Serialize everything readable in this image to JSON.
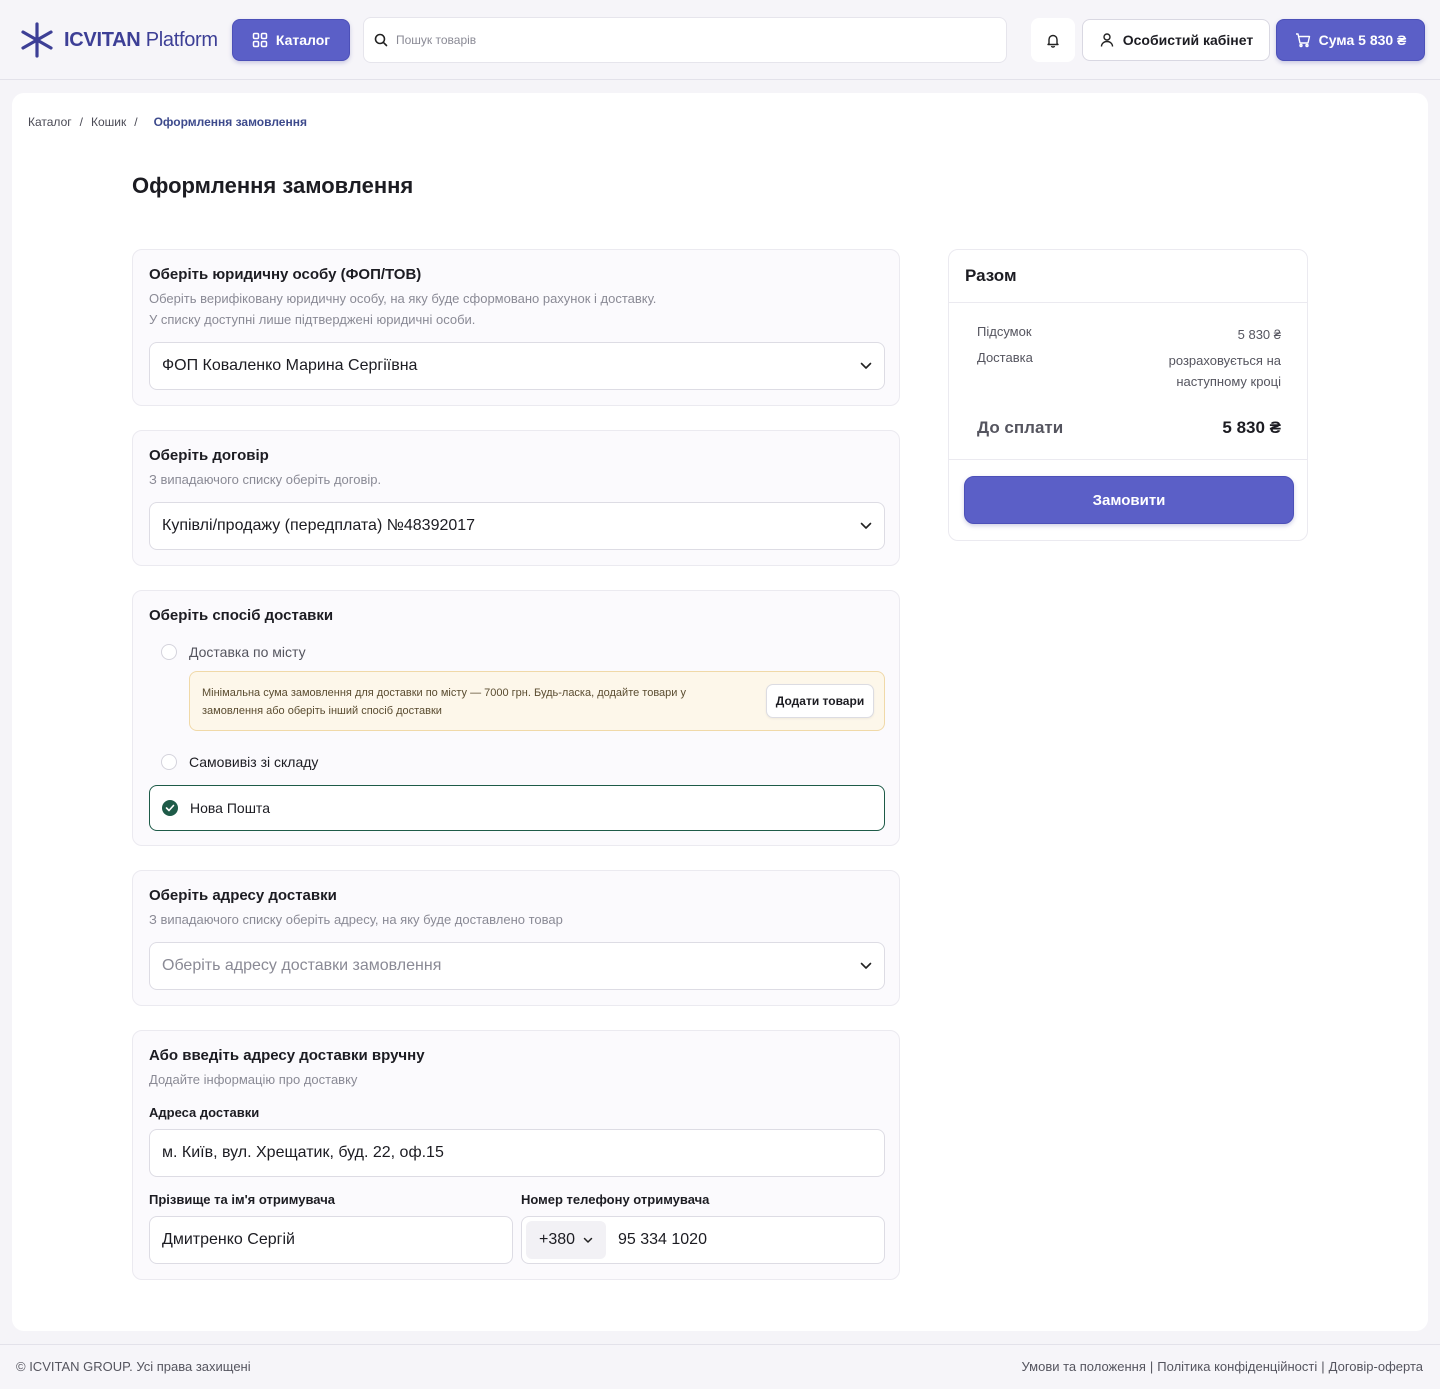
{
  "header": {
    "brand": "ICVITAN",
    "brand_suffix": "Platform",
    "catalog_label": "Каталог",
    "search_placeholder": "Пошук товарів",
    "account_label": "Особистий кабінет",
    "cart_label": "Сума 5 830 ₴"
  },
  "breadcrumb": {
    "items": [
      "Каталог",
      "Кошик"
    ],
    "current": "Оформлення замовлення"
  },
  "page_title": "Оформлення замовлення",
  "legal_entity": {
    "title": "Оберіть юридичну особу (ФОП/ТОВ)",
    "desc_1": "Оберіть верифіковану юридичну особу, на яку буде сформовано рахунок і доставку.",
    "desc_2": "У списку доступні лише підтверджені юридичні особи.",
    "selected": "ФОП Коваленко Марина Сергіївна"
  },
  "contract": {
    "title": "Оберіть договір",
    "desc": "З випадаючого списку оберіть договір.",
    "selected": "Купівлі/продажу (передплата) №48392017"
  },
  "delivery": {
    "title": "Оберіть спосіб доставки",
    "option_city": "Доставка по місту",
    "notice": "Мінімальна сума замовлення для доставки по місту — 7000 грн. Будь-ласка, додайте товари у замовлення або оберіть інший спосіб доставки",
    "add_items_label": "Додати товари",
    "option_pickup": "Самовивіз зі складу",
    "option_nova": "Нова Пошта"
  },
  "address_select": {
    "title": "Оберіть адресу доставки",
    "desc": "З випадаючого списку оберіть адресу, на яку буде доставлено товар",
    "placeholder": "Оберіть адресу доставки замовлення"
  },
  "manual_address": {
    "title": "Або введіть адресу доставки вручну",
    "desc": "Додайте інформацію про доставку",
    "address_label": "Адреса доставки",
    "address_value": "м. Київ, вул. Хрещатик, буд. 22, оф.15",
    "name_label": "Прізвище та ім'я отримувача",
    "name_value": "Дмитренко Сергій",
    "phone_label": "Номер телефону отримувача",
    "phone_code": "+380",
    "phone_value": "95 334 1020"
  },
  "summary": {
    "title": "Разом",
    "subtotal_label": "Підсумок",
    "subtotal_value": "5 830 ₴",
    "delivery_label": "Доставка",
    "delivery_value_1": "розраховується на",
    "delivery_value_2": "наступному кроці",
    "total_label": "До сплати",
    "total_value": "5 830 ₴",
    "order_label": "Замовити"
  },
  "footer": {
    "copyright": "© ICVITAN GROUP. Усі права захищені",
    "links": [
      "Умови та положення",
      "Політика конфіденційності",
      "Договір-оферта"
    ]
  },
  "colors": {
    "accent": "#5b5fc7",
    "selected_border": "#1e5b48",
    "notice_bg": "#fdf7ea"
  }
}
